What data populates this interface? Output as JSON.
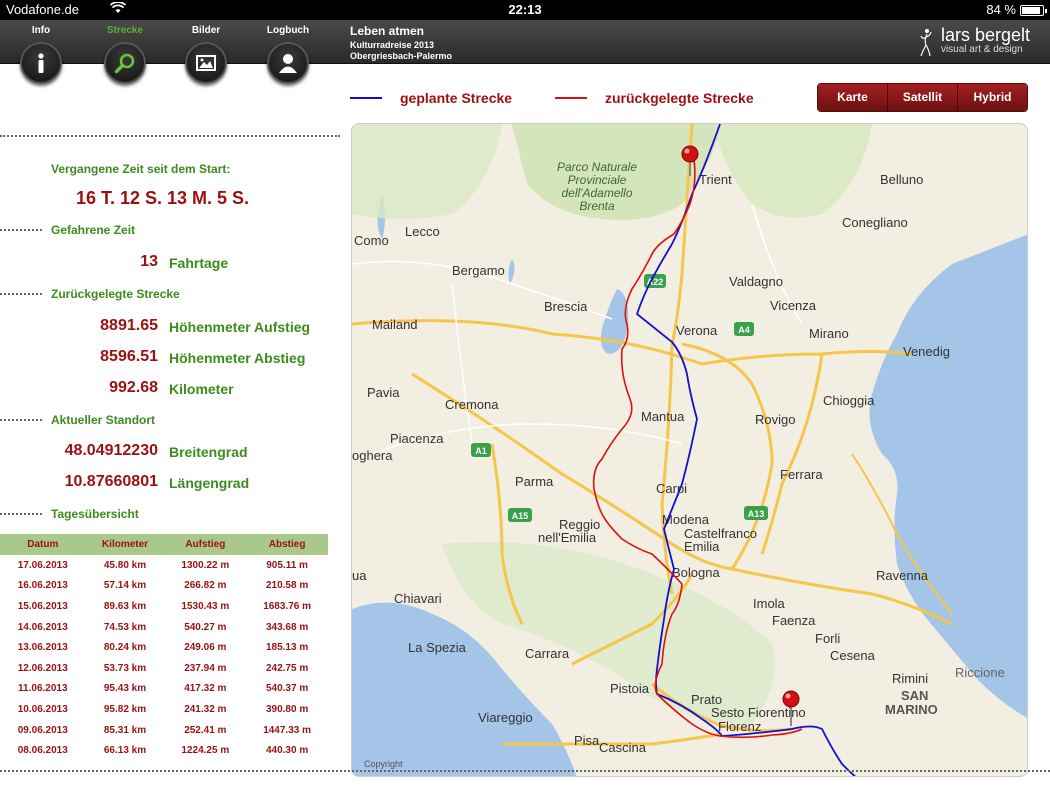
{
  "statusbar": {
    "carrier": "Vodafone.de",
    "time": "22:13",
    "battery": "84 %"
  },
  "nav": [
    {
      "label": "Info",
      "icon": "info-icon",
      "active": false
    },
    {
      "label": "Strecke",
      "icon": "search-icon",
      "active": true
    },
    {
      "label": "Bilder",
      "icon": "picture-icon",
      "active": false
    },
    {
      "label": "Logbuch",
      "icon": "person-icon",
      "active": false
    }
  ],
  "project": {
    "title": "Leben atmen",
    "subtitle": "Kulturradreise 2013",
    "route": "Obergriesbach-Palermo"
  },
  "brand": {
    "name": "lars bergelt",
    "tagline": "visual art & design"
  },
  "legend": {
    "planned": "geplante Strecke",
    "traveled": "zurückgelegte Strecke",
    "planned_color": "#1010d0",
    "traveled_color": "#e01010"
  },
  "maptype": {
    "options": [
      "Karte",
      "Satellit",
      "Hybrid"
    ],
    "selected": "Karte"
  },
  "stats": {
    "elapsed_label": "Vergangene Zeit seit dem Start:",
    "elapsed_value": "16 T. 12 S. 13 M. 5 S.",
    "ride_label": "Gefahrene Zeit",
    "ride_days": "13",
    "ride_days_unit": "Fahrtage",
    "distance_label": "Zurückgelegte Strecke",
    "ascent": "8891.65",
    "ascent_unit": "Höhenmeter Aufstieg",
    "descent": "8596.51",
    "descent_unit": "Höhenmeter Abstieg",
    "km": "992.68",
    "km_unit": "Kilometer",
    "location_label": "Aktueller Standort",
    "lat": "48.04912230",
    "lat_unit": "Breitengrad",
    "lon": "10.87660801",
    "lon_unit": "Längengrad",
    "daily_label": "Tagesübersicht"
  },
  "table": {
    "headers": [
      "Datum",
      "Kilometer",
      "Aufstieg",
      "Abstieg"
    ],
    "rows": [
      [
        "17.06.2013",
        "45.80 km",
        "1300.22 m",
        "905.11 m"
      ],
      [
        "16.06.2013",
        "57.14 km",
        "266.82 m",
        "210.58 m"
      ],
      [
        "15.06.2013",
        "89.63 km",
        "1530.43 m",
        "1683.76 m"
      ],
      [
        "14.06.2013",
        "74.53 km",
        "540.27 m",
        "343.68 m"
      ],
      [
        "13.06.2013",
        "80.24 km",
        "249.06 m",
        "185.13 m"
      ],
      [
        "12.06.2013",
        "53.73 km",
        "237.94 m",
        "242.75 m"
      ],
      [
        "11.06.2013",
        "95.43 km",
        "417.32 m",
        "540.37 m"
      ],
      [
        "10.06.2013",
        "95.82 km",
        "241.32 m",
        "390.80 m"
      ],
      [
        "09.06.2013",
        "85.31 km",
        "252.41 m",
        "1447.33 m"
      ],
      [
        "08.06.2013",
        "66.13 km",
        "1224.25 m",
        "440.30 m"
      ]
    ]
  },
  "map": {
    "copyright": "Copyright",
    "park_label": [
      "Parco Naturale",
      "Provinciale",
      "dell'Adamello",
      "Brenta"
    ],
    "cities": [
      "Trient",
      "Belluno",
      "Conegliano",
      "Lecco",
      "Como",
      "Bergamo",
      "Valdagno",
      "Brescia",
      "Vicenza",
      "Mailand",
      "Verona",
      "Mirano",
      "Venedig",
      "Pavia",
      "Cremona",
      "Mantua",
      "Chioggia",
      "Rovigo",
      "Piacenza",
      "oghera",
      "Ferrara",
      "Parma",
      "Carpi",
      "Reggio",
      "nell'Emilia",
      "Modena",
      "Castelfranco",
      "Emilia",
      "Bologna",
      "Ravenna",
      "Chiavari",
      "Imola",
      "Faenza",
      "Forli",
      "La Spezia",
      "Carrara",
      "Cesena",
      "Rimini",
      "Riccione",
      "SAN",
      "MARINO",
      "Pistoia",
      "Prato",
      "Sesto Fiorentino",
      "Viareggio",
      "Florenz",
      "Pisa",
      "Cascina",
      "ua"
    ],
    "roads": [
      "A22",
      "A4",
      "A1",
      "A15",
      "A13"
    ]
  }
}
